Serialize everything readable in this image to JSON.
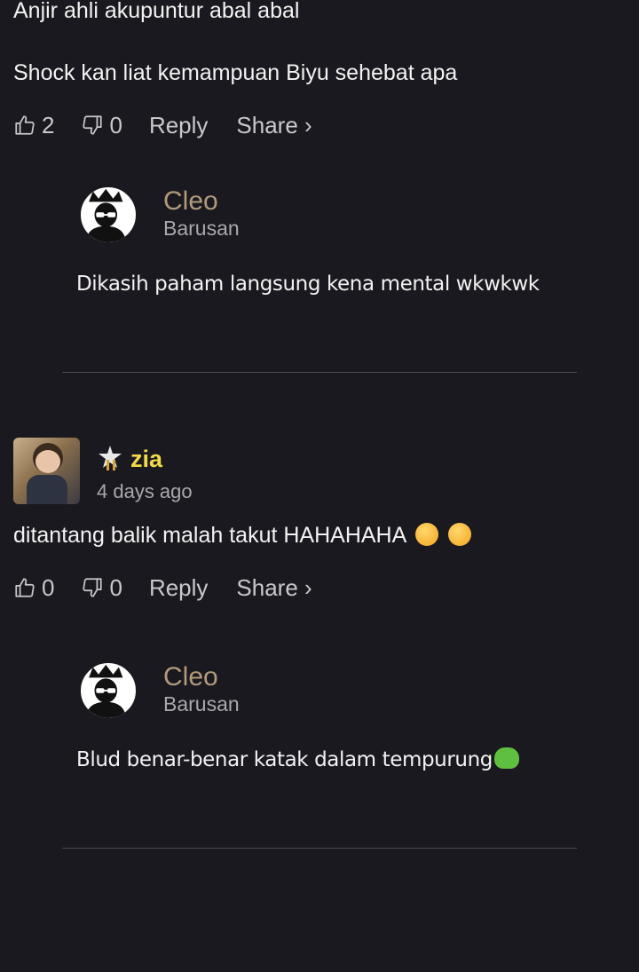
{
  "comments": [
    {
      "text_top": "Anjir ahli akupuntur abal abal",
      "text": "Shock kan liat kemampuan Biyu sehebat apa",
      "likes": "2",
      "dislikes": "0",
      "reply_label": "Reply",
      "share_label": "Share ›",
      "reply": {
        "name": "Cleo",
        "time": "Barusan",
        "text": "Dikasih paham langsung kena mental wkwkwk"
      }
    },
    {
      "name": "zia",
      "time": "4 days ago",
      "text": "ditantang balik malah takut HAHAHAHA",
      "likes": "0",
      "dislikes": "0",
      "reply_label": "Reply",
      "share_label": "Share ›",
      "reply": {
        "name": "Cleo",
        "time": "Barusan",
        "text": "Blud benar-benar katak dalam tempurung"
      }
    }
  ],
  "colors": {
    "background": "#1a191f",
    "reply_name": "#b19a7a",
    "zia_name": "#f1d94a"
  },
  "icons": [
    "thumbs-up-icon",
    "thumbs-down-icon",
    "crown-icon",
    "star-badge-icon",
    "rofl-emoji-icon",
    "frog-emoji-icon"
  ]
}
